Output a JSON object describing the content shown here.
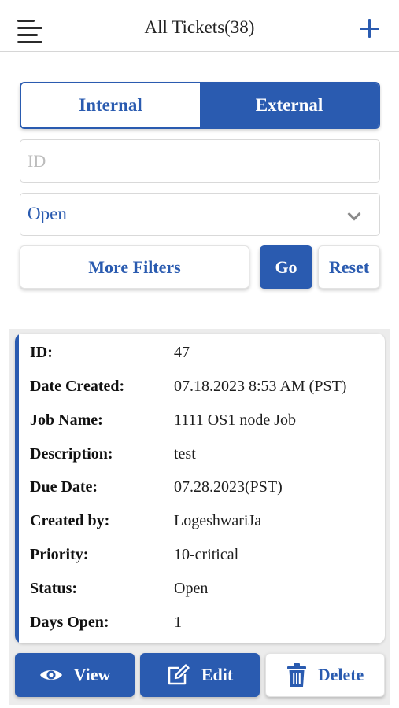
{
  "header": {
    "title": "All Tickets(38)",
    "menu_icon": "hamburger-menu-icon",
    "add_icon": "plus-icon"
  },
  "tabs": [
    {
      "label": "Internal",
      "active": false
    },
    {
      "label": "External",
      "active": true
    }
  ],
  "filters": {
    "id_placeholder": "ID",
    "id_value": "",
    "status_value": "Open",
    "more_filters_label": "More Filters",
    "go_label": "Go",
    "reset_label": "Reset"
  },
  "ticket": {
    "fields": [
      {
        "label": "ID:",
        "value": "47"
      },
      {
        "label": "Date Created:",
        "value": "07.18.2023 8:53 AM (PST)"
      },
      {
        "label": "Job Name:",
        "value": "1111 OS1 node Job"
      },
      {
        "label": "Description:",
        "value": "test"
      },
      {
        "label": "Due Date:",
        "value": "07.28.2023(PST)"
      },
      {
        "label": "Created by:",
        "value": "LogeshwariJa"
      },
      {
        "label": "Priority:",
        "value": "10-critical"
      },
      {
        "label": "Status:",
        "value": "Open"
      },
      {
        "label": "Days Open:",
        "value": "1"
      }
    ],
    "actions": {
      "view_label": "View",
      "edit_label": "Edit",
      "delete_label": "Delete"
    }
  },
  "colors": {
    "accent": "#2a5bb0",
    "card_background": "#ececec"
  }
}
